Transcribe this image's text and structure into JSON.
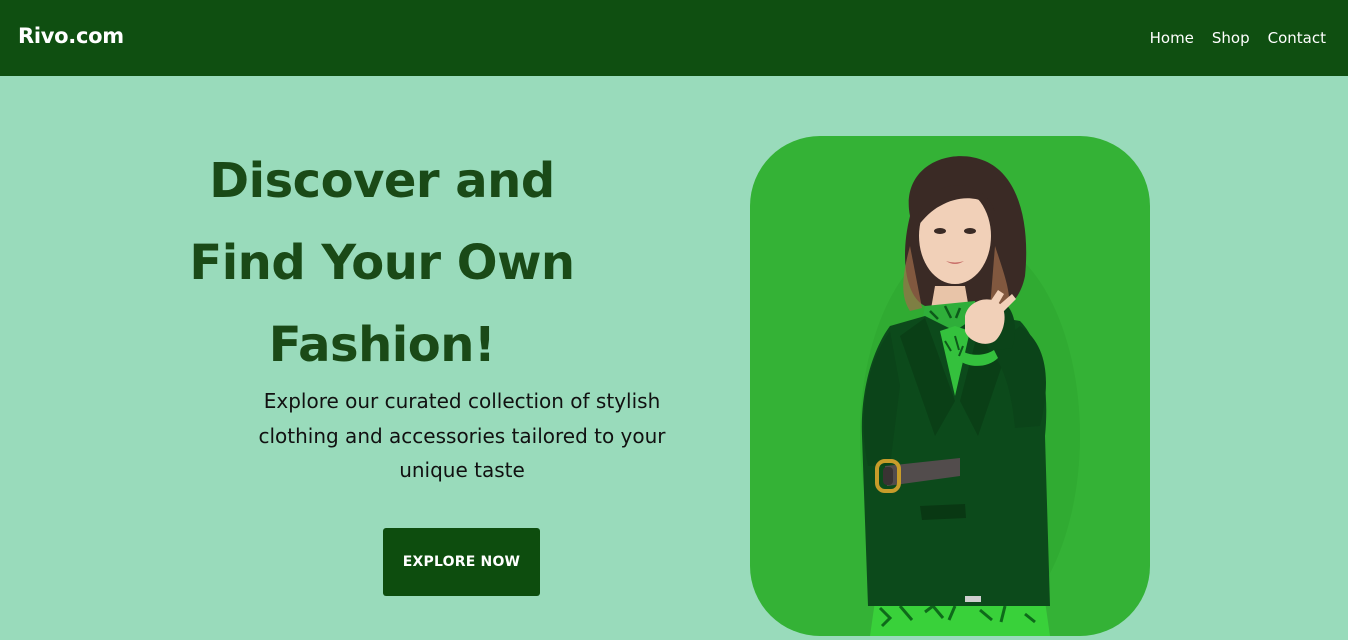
{
  "brand": {
    "logo_text": "Rivo.com"
  },
  "nav": {
    "items": [
      {
        "label": "Home"
      },
      {
        "label": "Shop"
      },
      {
        "label": "Contact"
      }
    ]
  },
  "hero": {
    "headline_lines": [
      "Discover and",
      "Find Your Own",
      "Fashion!"
    ],
    "description": "Explore our curated collection of stylish clothing and accessories tailored to your unique taste",
    "cta_label": "EXPLORE NOW"
  },
  "colors": {
    "navbar_bg": "#0f4f11",
    "page_bg": "#99dbbb",
    "headline": "#1a4a17",
    "cta_bg": "#0d4d0e",
    "image_card_bg": "#34b236"
  }
}
